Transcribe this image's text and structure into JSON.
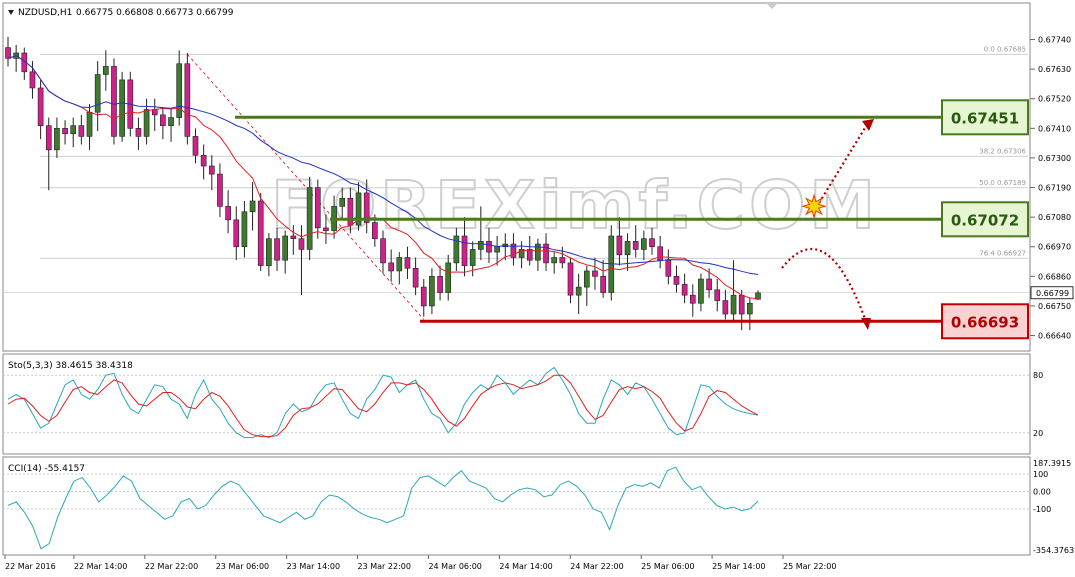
{
  "chart_data": {
    "type": "candlestick",
    "title": "NZDUSD,H1",
    "ohlc_header": "0.66775 0.66808 0.66773 0.66799",
    "current_price": "0.66799",
    "price_axis": {
      "ylim": [
        0.6659,
        0.6782
      ],
      "ticks": [
        "0.67740",
        "0.67630",
        "0.67520",
        "0.67410",
        "0.67300",
        "0.67190",
        "0.67080",
        "0.66970",
        "0.66860",
        "0.66750",
        "0.66640"
      ]
    },
    "time_labels": [
      "22 Mar 2016",
      "22 Mar 14:00",
      "22 Mar 22:00",
      "23 Mar 06:00",
      "23 Mar 14:00",
      "23 Mar 22:00",
      "24 Mar 06:00",
      "24 Mar 14:00",
      "24 Mar 22:00",
      "25 Mar 06:00",
      "25 Mar 14:00",
      "25 Mar 22:00"
    ],
    "candles": [
      {
        "o": 0.6771,
        "h": 0.6775,
        "l": 0.6764,
        "c": 0.6767
      },
      {
        "o": 0.6767,
        "h": 0.6772,
        "l": 0.6762,
        "c": 0.6769
      },
      {
        "o": 0.6769,
        "h": 0.6771,
        "l": 0.6759,
        "c": 0.6762
      },
      {
        "o": 0.6762,
        "h": 0.6766,
        "l": 0.6752,
        "c": 0.6756
      },
      {
        "o": 0.6756,
        "h": 0.6759,
        "l": 0.6737,
        "c": 0.6742
      },
      {
        "o": 0.6742,
        "h": 0.6745,
        "l": 0.6718,
        "c": 0.6733
      },
      {
        "o": 0.6733,
        "h": 0.6745,
        "l": 0.673,
        "c": 0.6741
      },
      {
        "o": 0.6741,
        "h": 0.6744,
        "l": 0.6735,
        "c": 0.6739
      },
      {
        "o": 0.6739,
        "h": 0.6745,
        "l": 0.6734,
        "c": 0.6742
      },
      {
        "o": 0.6742,
        "h": 0.6746,
        "l": 0.6735,
        "c": 0.6738
      },
      {
        "o": 0.6738,
        "h": 0.675,
        "l": 0.6733,
        "c": 0.6747
      },
      {
        "o": 0.6747,
        "h": 0.6766,
        "l": 0.674,
        "c": 0.6761
      },
      {
        "o": 0.6761,
        "h": 0.677,
        "l": 0.6755,
        "c": 0.6764
      },
      {
        "o": 0.6764,
        "h": 0.6767,
        "l": 0.6735,
        "c": 0.6738
      },
      {
        "o": 0.6738,
        "h": 0.6762,
        "l": 0.6736,
        "c": 0.6759
      },
      {
        "o": 0.6759,
        "h": 0.6762,
        "l": 0.6738,
        "c": 0.6741
      },
      {
        "o": 0.6741,
        "h": 0.6745,
        "l": 0.6733,
        "c": 0.6738
      },
      {
        "o": 0.6738,
        "h": 0.6752,
        "l": 0.6735,
        "c": 0.6748
      },
      {
        "o": 0.6748,
        "h": 0.6752,
        "l": 0.674,
        "c": 0.6746
      },
      {
        "o": 0.6746,
        "h": 0.6749,
        "l": 0.6737,
        "c": 0.6742
      },
      {
        "o": 0.6742,
        "h": 0.6748,
        "l": 0.6736,
        "c": 0.6745
      },
      {
        "o": 0.6745,
        "h": 0.677,
        "l": 0.6742,
        "c": 0.6765
      },
      {
        "o": 0.6765,
        "h": 0.6769,
        "l": 0.6735,
        "c": 0.6738
      },
      {
        "o": 0.6738,
        "h": 0.6741,
        "l": 0.6728,
        "c": 0.6731
      },
      {
        "o": 0.6731,
        "h": 0.6735,
        "l": 0.6722,
        "c": 0.6727
      },
      {
        "o": 0.6727,
        "h": 0.6731,
        "l": 0.6718,
        "c": 0.6724
      },
      {
        "o": 0.6724,
        "h": 0.6728,
        "l": 0.6708,
        "c": 0.6712
      },
      {
        "o": 0.6712,
        "h": 0.6718,
        "l": 0.6702,
        "c": 0.6707
      },
      {
        "o": 0.6707,
        "h": 0.6712,
        "l": 0.6692,
        "c": 0.6697
      },
      {
        "o": 0.6697,
        "h": 0.6714,
        "l": 0.6693,
        "c": 0.671
      },
      {
        "o": 0.671,
        "h": 0.6721,
        "l": 0.6703,
        "c": 0.6714
      },
      {
        "o": 0.6714,
        "h": 0.6717,
        "l": 0.6688,
        "c": 0.669
      },
      {
        "o": 0.669,
        "h": 0.6702,
        "l": 0.6686,
        "c": 0.67
      },
      {
        "o": 0.67,
        "h": 0.6704,
        "l": 0.6688,
        "c": 0.6692
      },
      {
        "o": 0.6692,
        "h": 0.6703,
        "l": 0.6687,
        "c": 0.6701
      },
      {
        "o": 0.6701,
        "h": 0.6705,
        "l": 0.6694,
        "c": 0.67
      },
      {
        "o": 0.67,
        "h": 0.6705,
        "l": 0.6679,
        "c": 0.6696
      },
      {
        "o": 0.6696,
        "h": 0.6723,
        "l": 0.6692,
        "c": 0.6719
      },
      {
        "o": 0.6719,
        "h": 0.6722,
        "l": 0.67,
        "c": 0.6704
      },
      {
        "o": 0.6704,
        "h": 0.6709,
        "l": 0.6698,
        "c": 0.6703
      },
      {
        "o": 0.6703,
        "h": 0.6716,
        "l": 0.67,
        "c": 0.6712
      },
      {
        "o": 0.6712,
        "h": 0.6719,
        "l": 0.6707,
        "c": 0.6715
      },
      {
        "o": 0.6715,
        "h": 0.6719,
        "l": 0.6702,
        "c": 0.6705
      },
      {
        "o": 0.6705,
        "h": 0.6721,
        "l": 0.6703,
        "c": 0.6717
      },
      {
        "o": 0.6717,
        "h": 0.6722,
        "l": 0.6702,
        "c": 0.6706
      },
      {
        "o": 0.6706,
        "h": 0.6709,
        "l": 0.6697,
        "c": 0.67
      },
      {
        "o": 0.67,
        "h": 0.6703,
        "l": 0.6687,
        "c": 0.6691
      },
      {
        "o": 0.6691,
        "h": 0.6696,
        "l": 0.6684,
        "c": 0.6688
      },
      {
        "o": 0.6688,
        "h": 0.6695,
        "l": 0.6683,
        "c": 0.6693
      },
      {
        "o": 0.6693,
        "h": 0.6697,
        "l": 0.6685,
        "c": 0.6689
      },
      {
        "o": 0.6689,
        "h": 0.6693,
        "l": 0.6679,
        "c": 0.6682
      },
      {
        "o": 0.6682,
        "h": 0.6685,
        "l": 0.6671,
        "c": 0.6675
      },
      {
        "o": 0.6675,
        "h": 0.6689,
        "l": 0.6672,
        "c": 0.6686
      },
      {
        "o": 0.6686,
        "h": 0.669,
        "l": 0.6677,
        "c": 0.668
      },
      {
        "o": 0.668,
        "h": 0.6694,
        "l": 0.6677,
        "c": 0.6691
      },
      {
        "o": 0.6691,
        "h": 0.6704,
        "l": 0.6688,
        "c": 0.6701
      },
      {
        "o": 0.6701,
        "h": 0.6708,
        "l": 0.6686,
        "c": 0.669
      },
      {
        "o": 0.669,
        "h": 0.6699,
        "l": 0.6686,
        "c": 0.6696
      },
      {
        "o": 0.6696,
        "h": 0.6712,
        "l": 0.6692,
        "c": 0.6699
      },
      {
        "o": 0.6699,
        "h": 0.6704,
        "l": 0.6691,
        "c": 0.6695
      },
      {
        "o": 0.6695,
        "h": 0.6701,
        "l": 0.669,
        "c": 0.6697
      },
      {
        "o": 0.6697,
        "h": 0.6702,
        "l": 0.6692,
        "c": 0.6698
      },
      {
        "o": 0.6698,
        "h": 0.6702,
        "l": 0.669,
        "c": 0.6693
      },
      {
        "o": 0.6693,
        "h": 0.6699,
        "l": 0.6689,
        "c": 0.6696
      },
      {
        "o": 0.6696,
        "h": 0.6701,
        "l": 0.669,
        "c": 0.6692
      },
      {
        "o": 0.6692,
        "h": 0.67,
        "l": 0.6688,
        "c": 0.6698
      },
      {
        "o": 0.6698,
        "h": 0.6702,
        "l": 0.6688,
        "c": 0.6691
      },
      {
        "o": 0.6691,
        "h": 0.6695,
        "l": 0.6687,
        "c": 0.6693
      },
      {
        "o": 0.6693,
        "h": 0.6697,
        "l": 0.6689,
        "c": 0.6691
      },
      {
        "o": 0.6691,
        "h": 0.6693,
        "l": 0.6676,
        "c": 0.6679
      },
      {
        "o": 0.6679,
        "h": 0.6687,
        "l": 0.6672,
        "c": 0.6682
      },
      {
        "o": 0.6682,
        "h": 0.669,
        "l": 0.6675,
        "c": 0.6688
      },
      {
        "o": 0.6688,
        "h": 0.6693,
        "l": 0.6681,
        "c": 0.6686
      },
      {
        "o": 0.6686,
        "h": 0.6692,
        "l": 0.6678,
        "c": 0.668
      },
      {
        "o": 0.668,
        "h": 0.6705,
        "l": 0.6677,
        "c": 0.6701
      },
      {
        "o": 0.6701,
        "h": 0.6708,
        "l": 0.669,
        "c": 0.6694
      },
      {
        "o": 0.6694,
        "h": 0.6702,
        "l": 0.6688,
        "c": 0.6699
      },
      {
        "o": 0.6699,
        "h": 0.6705,
        "l": 0.6693,
        "c": 0.6696
      },
      {
        "o": 0.6696,
        "h": 0.6703,
        "l": 0.6692,
        "c": 0.67
      },
      {
        "o": 0.67,
        "h": 0.6704,
        "l": 0.6694,
        "c": 0.6697
      },
      {
        "o": 0.6697,
        "h": 0.6701,
        "l": 0.6689,
        "c": 0.6692
      },
      {
        "o": 0.6692,
        "h": 0.6696,
        "l": 0.6683,
        "c": 0.6686
      },
      {
        "o": 0.6686,
        "h": 0.669,
        "l": 0.668,
        "c": 0.6683
      },
      {
        "o": 0.6683,
        "h": 0.6687,
        "l": 0.6676,
        "c": 0.6679
      },
      {
        "o": 0.6679,
        "h": 0.6683,
        "l": 0.6671,
        "c": 0.6676
      },
      {
        "o": 0.6676,
        "h": 0.6687,
        "l": 0.6673,
        "c": 0.6685
      },
      {
        "o": 0.6685,
        "h": 0.6689,
        "l": 0.6678,
        "c": 0.6681
      },
      {
        "o": 0.6681,
        "h": 0.6685,
        "l": 0.6673,
        "c": 0.6677
      },
      {
        "o": 0.6677,
        "h": 0.6681,
        "l": 0.667,
        "c": 0.6672
      },
      {
        "o": 0.6672,
        "h": 0.6692,
        "l": 0.6669,
        "c": 0.6679
      },
      {
        "o": 0.6679,
        "h": 0.6681,
        "l": 0.6666,
        "c": 0.6672
      },
      {
        "o": 0.6672,
        "h": 0.6678,
        "l": 0.6666,
        "c": 0.6676
      },
      {
        "o": 0.66775,
        "h": 0.66808,
        "l": 0.66773,
        "c": 0.66799
      }
    ],
    "fibonacci": [
      {
        "label": "0.0",
        "price": "0.67685"
      },
      {
        "label": "38.2",
        "price": "0.67306"
      },
      {
        "label": "50.0",
        "price": "0.67189"
      },
      {
        "label": "76.4",
        "price": "0.66927"
      }
    ],
    "levels": [
      {
        "value": "0.67451",
        "kind": "resistance"
      },
      {
        "value": "0.67072",
        "kind": "resistance"
      },
      {
        "value": "0.66693",
        "kind": "support"
      }
    ],
    "watermark": "FOREXimf.COM",
    "stochastic": {
      "label": "Sto(5,3,3) 38.4615 38.4318",
      "ticks": [
        "80",
        "20"
      ],
      "main": [
        55,
        60,
        55,
        40,
        25,
        30,
        50,
        70,
        75,
        60,
        55,
        65,
        80,
        82,
        60,
        45,
        40,
        55,
        70,
        68,
        55,
        50,
        35,
        60,
        75,
        55,
        45,
        30,
        20,
        15,
        15,
        18,
        15,
        20,
        40,
        50,
        42,
        45,
        60,
        70,
        72,
        55,
        40,
        35,
        55,
        65,
        80,
        78,
        62,
        70,
        75,
        55,
        40,
        35,
        20,
        30,
        50,
        62,
        70,
        65,
        80,
        72,
        60,
        68,
        75,
        70,
        82,
        88,
        75,
        60,
        40,
        30,
        30,
        55,
        75,
        70,
        60,
        72,
        68,
        55,
        40,
        25,
        18,
        20,
        45,
        70,
        68,
        58,
        50,
        45,
        42,
        40,
        38.46
      ],
      "signal": [
        50,
        55,
        56,
        48,
        38,
        32,
        38,
        52,
        65,
        68,
        62,
        60,
        68,
        75,
        72,
        60,
        50,
        48,
        55,
        62,
        62,
        56,
        47,
        45,
        55,
        62,
        58,
        48,
        35,
        23,
        18,
        16,
        16,
        17,
        25,
        38,
        45,
        46,
        50,
        58,
        66,
        65,
        55,
        45,
        42,
        50,
        62,
        72,
        72,
        70,
        72,
        65,
        55,
        42,
        32,
        27,
        35,
        48,
        60,
        66,
        70,
        72,
        70,
        66,
        68,
        70,
        74,
        80,
        80,
        72,
        58,
        44,
        34,
        38,
        52,
        65,
        68,
        66,
        68,
        63,
        56,
        42,
        30,
        22,
        25,
        40,
        58,
        64,
        62,
        55,
        48,
        43,
        38.43
      ]
    },
    "cci": {
      "label": "CCI(14) -55.4157",
      "ticks": [
        "187.3915",
        "100",
        "0.00",
        "-100",
        "-354.3763"
      ],
      "values": [
        -80,
        -60,
        -120,
        -200,
        -330,
        -300,
        -150,
        -40,
        60,
        80,
        20,
        -60,
        -20,
        30,
        90,
        60,
        -40,
        -80,
        -120,
        -160,
        -140,
        -60,
        -40,
        -100,
        -80,
        -20,
        30,
        60,
        40,
        -20,
        -80,
        -140,
        -160,
        -180,
        -150,
        -120,
        -160,
        -140,
        -60,
        -20,
        -30,
        -60,
        -100,
        -130,
        -150,
        -160,
        -180,
        -160,
        -140,
        20,
        80,
        90,
        60,
        30,
        80,
        120,
        60,
        40,
        20,
        -40,
        -60,
        -20,
        10,
        20,
        10,
        -30,
        -20,
        40,
        60,
        30,
        -20,
        -100,
        -120,
        -220,
        -80,
        20,
        40,
        30,
        50,
        20,
        120,
        140,
        60,
        10,
        30,
        -30,
        -80,
        -100,
        -90,
        -110,
        -100,
        -55.42
      ]
    },
    "colors": {
      "bull": "#3e7a2e",
      "bear": "#d0208a",
      "ma_fast": "#e02020",
      "ma_slow": "#2030c8",
      "resistance": "#4a7a1e",
      "support": "#c00000"
    }
  }
}
